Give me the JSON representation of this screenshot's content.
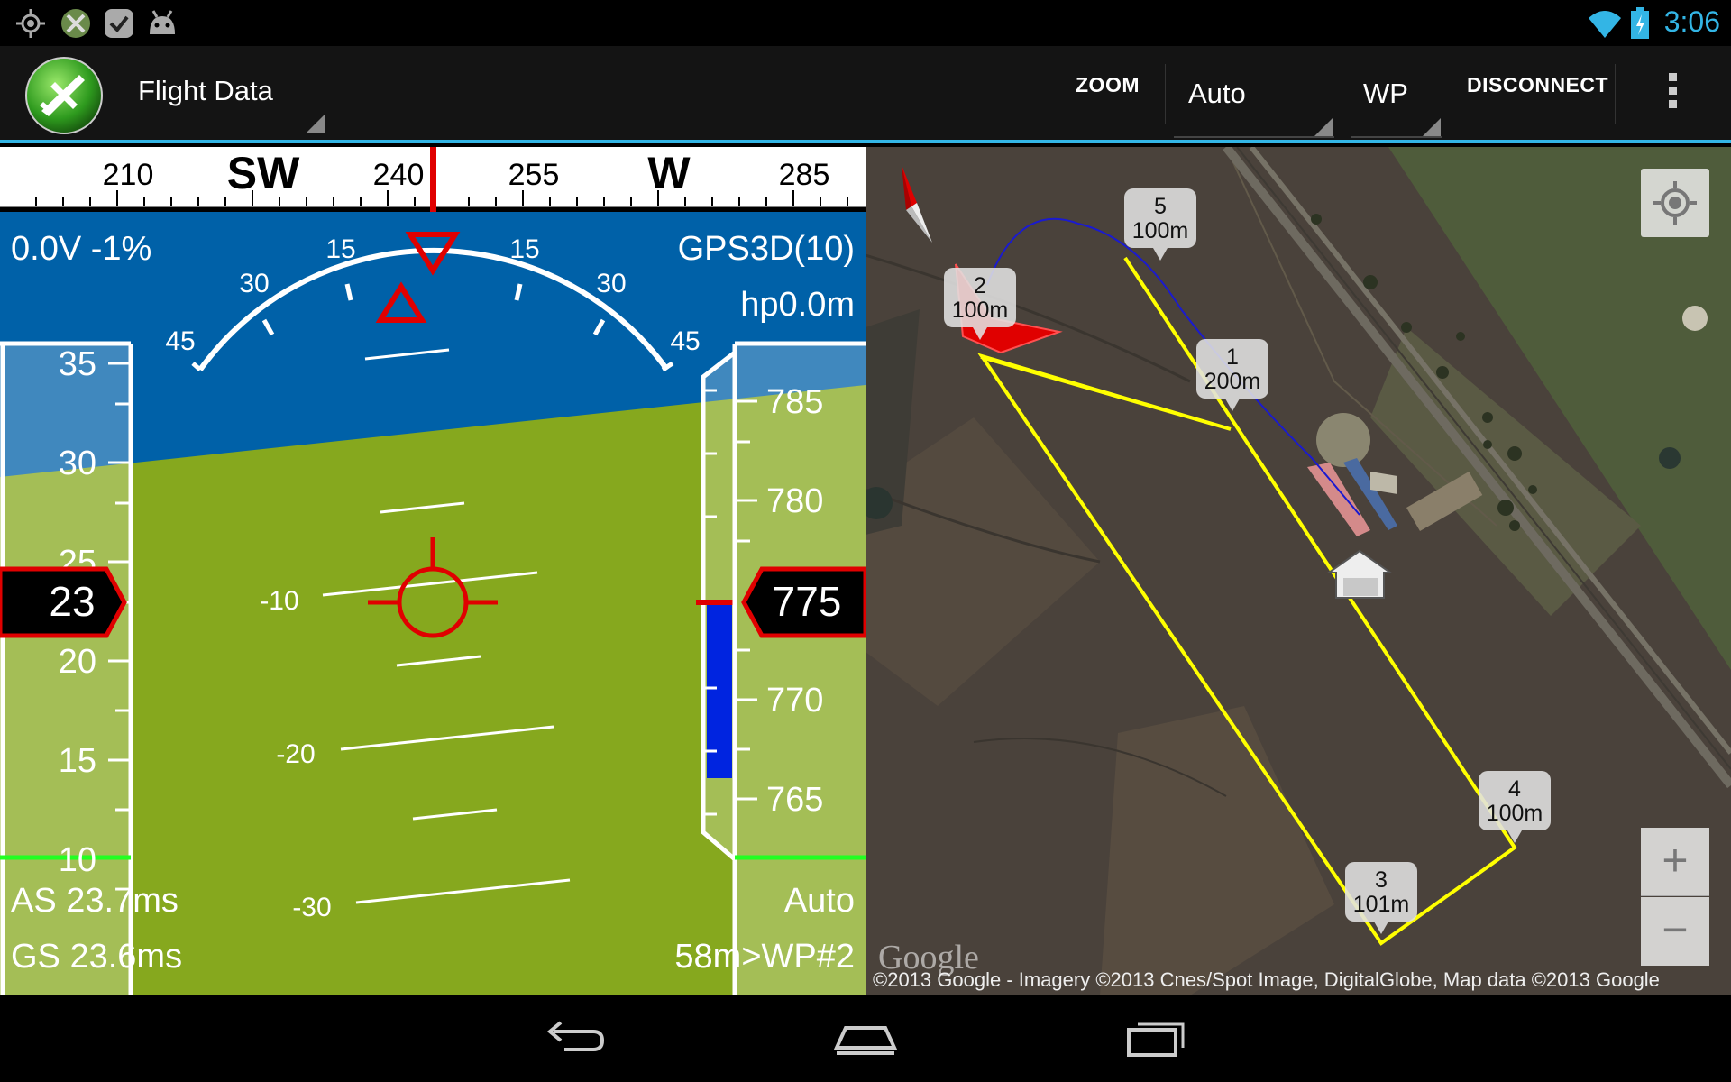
{
  "status_bar": {
    "time": "3:06",
    "icons_left": [
      "gps-icon",
      "app-notification-icon",
      "check-icon",
      "android-icon"
    ],
    "icons_right": [
      "wifi-icon",
      "battery-icon"
    ]
  },
  "action_bar": {
    "title": "Flight Data",
    "zoom_label": "ZOOM",
    "mode_value": "Auto",
    "wp_value": "WP",
    "disconnect_label": "DISCONNECT"
  },
  "hud": {
    "heading_ticks": [
      "210",
      "SW",
      "240",
      "255",
      "W",
      "285"
    ],
    "battery": "0.0V  -1%",
    "gps": "GPS3D(10)",
    "home_alt": "hp0.0m",
    "roll_labels": [
      "45",
      "30",
      "15",
      "15",
      "30",
      "45"
    ],
    "pitch_labels": [
      "-10",
      "-20",
      "-30"
    ],
    "speed_tape_ticks": [
      "35",
      "30",
      "25",
      "20",
      "15",
      "10"
    ],
    "speed_value": "23",
    "alt_tape_ticks": [
      "785",
      "780",
      "775",
      "770",
      "765"
    ],
    "alt_value": "775",
    "airspeed": "AS 23.7ms",
    "groundspeed": "GS 23.6ms",
    "flight_mode": "Auto",
    "wp_distance": "58m>WP#2"
  },
  "map": {
    "waypoints": [
      {
        "num": "1",
        "alt": "200m"
      },
      {
        "num": "2",
        "alt": "100m"
      },
      {
        "num": "3",
        "alt": "101m"
      },
      {
        "num": "4",
        "alt": "100m"
      },
      {
        "num": "5",
        "alt": "100m"
      }
    ],
    "attribution": "©2013 Google - Imagery ©2013 Cnes/Spot Image, DigitalGlobe, Map data ©2013 Google",
    "logo_text": "Google",
    "zoom_in": "+",
    "zoom_out": "−"
  },
  "colors": {
    "accent": "#33b5e5",
    "sky": "#0061a8",
    "ground": "#86a81e",
    "hud_red": "#e00000",
    "mission_line": "#ffff00"
  }
}
